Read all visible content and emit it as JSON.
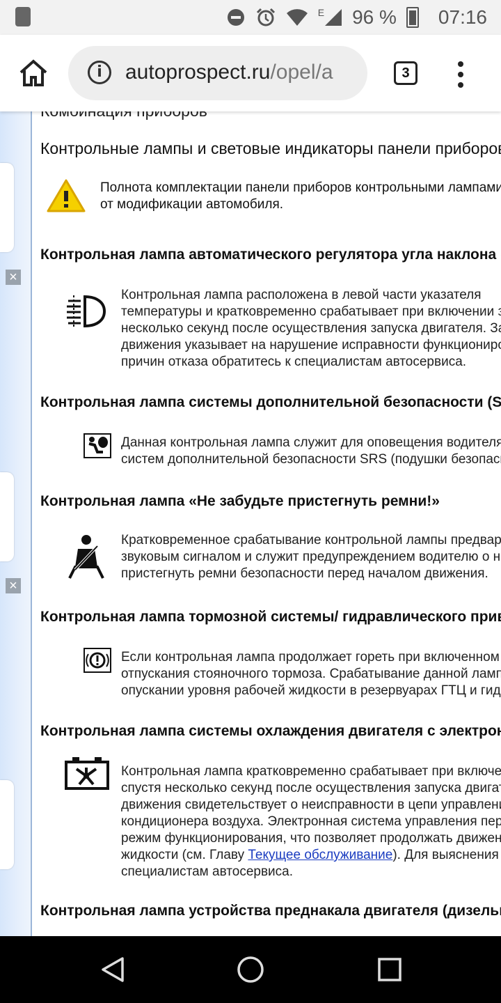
{
  "status_bar": {
    "battery": "96 %",
    "time": "07:16",
    "network_label": "E"
  },
  "browser": {
    "url_domain": "autoprospect.ru",
    "url_path": "/opel/a",
    "tab_count": "3"
  },
  "page": {
    "cut_heading": "Комбинация приборов",
    "subtitle": "Контрольные лампы и световые индикаторы панели приборов",
    "note_lines": [
      "Полнота комплектации панели приборов контрольными лампами зависит",
      "от модификации автомобиля."
    ],
    "sections": [
      {
        "title": "Контрольная лампа автоматического регулятора угла наклона фар",
        "icon": "headlamp-leveling-icon",
        "lines": [
          "Контрольная лампа расположена в левой части указателя",
          "температуры и кратковременно срабатывает при включении зажигания,",
          "несколько секунд после осуществления запуска двигателя. Загорание во время",
          "движения указывает на нарушение исправности функционирования системы. Для выяснения",
          "причин отказа обратитесь к специалистам автосервиса."
        ]
      },
      {
        "title": "Контрольная лампа системы дополнительной безопасности (SRS)",
        "icon": "airbag-icon",
        "lines": [
          "Данная контрольная лампа служит для оповещения водителя о неисправности",
          "систем дополнительной безопасности SRS (подушки безопасности)."
        ]
      },
      {
        "title": "Контрольная лампа «Не забудьте пристегнуть ремни!»",
        "icon": "seatbelt-icon",
        "lines": [
          "Кратковременное срабатывание контрольной лампы предваряется",
          "звуковым сигналом и служит предупреждением водителю о необходимости",
          "пристегнуть ремни безопасности перед началом движения."
        ]
      },
      {
        "title": "Контрольная лампа тормозной системы/ гидравлического привода сцепления",
        "icon": "brake-warning-icon",
        "lines": [
          "Если контрольная лампа продолжает гореть при включенном зажигании после",
          "отпускания стояночного тормоза. Срабатывание данной лампы сигнализирует об",
          "опускании уровня рабочей жидкости в резервуарах ГТЦ и гидропривода сцепления."
        ]
      },
      {
        "title": "Контрольная лампа системы охлаждения двигателя с электронным управлением",
        "icon": "engine-cooling-icon",
        "lines": [
          "Контрольная лампа кратковременно срабатывает при включении зажигания и гаснет",
          "спустя несколько секунд после осуществления запуска двигателя. Загорание во время",
          "движения свидетельствует о неисправности в цепи управления вентилятором",
          "кондиционера воздуха. Электронная система управления переходит в аварийный",
          "режим функционирования, что позволяет продолжать движение до",
          "жидкости (см. Главу ",
          "). Для выяснения причин обратитесь к",
          "специалистам автосервиса."
        ],
        "link": "Текущее обслуживание"
      },
      {
        "title": "Контрольная лампа устройства преднакала двигателя (дизельные модели)"
      }
    ]
  }
}
